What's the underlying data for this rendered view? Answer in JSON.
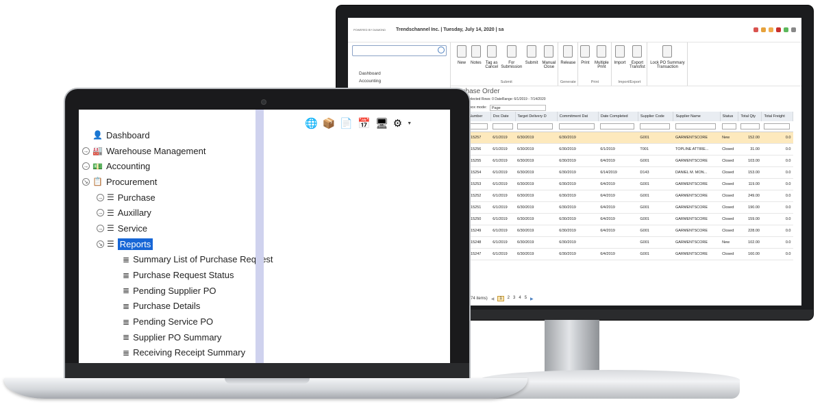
{
  "monitor": {
    "powered_by": "POWERED BY DIAMOND",
    "company_line": "Trendschannel Inc. | Tuesday, July 14, 2020 | sa",
    "sidebar": {
      "search_placeholder": "",
      "items": [
        {
          "label": "Dashboard"
        },
        {
          "label": "Accounting"
        }
      ]
    },
    "ribbon": {
      "groups": [
        {
          "label": "Submit",
          "buttons": [
            "New",
            "Notes",
            "Tag as Cancel",
            "For Submission",
            "Submit",
            "Manual Close"
          ]
        },
        {
          "label": "Generate",
          "buttons": [
            "Release"
          ]
        },
        {
          "label": "Print",
          "buttons": [
            "Print",
            "Multiple Print"
          ]
        },
        {
          "label": "Import/Export",
          "buttons": [
            "Import",
            "Export Transfist"
          ]
        },
        {
          "label": "",
          "buttons": [
            "Lock PO Summary Transaction"
          ]
        }
      ]
    },
    "page_title": "Purchase Order",
    "toolbar_text": "Selected Rows: 0 DateRange: 6/1/2019 - 7/14/2020",
    "checkbox_mode_label": "ct all checkbox mode:",
    "checkbox_mode_value": "Page",
    "grid": {
      "columns": [
        "Doc Number",
        "Doc Date",
        "Target Delivery D",
        "Commitment Dat",
        "Date Completed",
        "Supplier Code",
        "Supplier Name",
        "Status",
        "Total Qty",
        "Total Freight"
      ],
      "rows": [
        [
          "PO0015257",
          "6/1/2019",
          "6/30/2019",
          "6/30/2019",
          "",
          "G001",
          "GARMENTSCORE",
          "New",
          "152.00",
          "0.0"
        ],
        [
          "PO0015256",
          "6/1/2019",
          "6/30/2019",
          "6/30/2019",
          "6/1/2019",
          "T001",
          "TOPLINE ATTIRE...",
          "Closed",
          "31.00",
          "0.0"
        ],
        [
          "PO0015255",
          "6/1/2019",
          "6/30/2019",
          "6/30/2019",
          "6/4/2019",
          "G001",
          "GARMENTSCORE",
          "Closed",
          "103.00",
          "0.0"
        ],
        [
          "PO0015254",
          "6/1/2019",
          "6/30/2019",
          "6/30/2019",
          "6/14/2019",
          "D143",
          "DANIEL M. MON...",
          "Closed",
          "153.00",
          "0.0"
        ],
        [
          "PO0015253",
          "6/1/2019",
          "6/30/2019",
          "6/30/2019",
          "6/4/2019",
          "G001",
          "GARMENTSCORE",
          "Closed",
          "119.00",
          "0.0"
        ],
        [
          "PO0015252",
          "6/1/2019",
          "6/30/2019",
          "6/30/2019",
          "6/4/2019",
          "G001",
          "GARMENTSCORE",
          "Closed",
          "249.00",
          "0.0"
        ],
        [
          "PO0015251",
          "6/1/2019",
          "6/30/2019",
          "6/30/2019",
          "6/4/2019",
          "G001",
          "GARMENTSCORE",
          "Closed",
          "190.00",
          "0.0"
        ],
        [
          "PO0015250",
          "6/1/2019",
          "6/30/2019",
          "6/30/2019",
          "6/4/2019",
          "G001",
          "GARMENTSCORE",
          "Closed",
          "159.00",
          "0.0"
        ],
        [
          "PO0015249",
          "6/1/2019",
          "6/30/2019",
          "6/30/2019",
          "6/4/2019",
          "G001",
          "GARMENTSCORE",
          "Closed",
          "228.00",
          "0.0"
        ],
        [
          "PO0015248",
          "6/1/2019",
          "6/30/2019",
          "6/30/2019",
          "",
          "G001",
          "GARMENTSCORE",
          "New",
          "102.00",
          "0.0"
        ],
        [
          "PO0015247",
          "6/1/2019",
          "6/30/2019",
          "6/30/2019",
          "6/4/2019",
          "G001",
          "GARMENTSCORE",
          "Closed",
          "160.00",
          "0.0"
        ]
      ]
    },
    "pager": {
      "summary": "ge 1 of 5 (74 items)",
      "pages": [
        "1",
        "2",
        "3",
        "4",
        "5"
      ],
      "current": "1"
    }
  },
  "laptop": {
    "tree": [
      {
        "label": "Dashboard",
        "level": 0,
        "toggle": "",
        "icon": "dashboard-icon"
      },
      {
        "label": "Warehouse Management",
        "level": 0,
        "toggle": "expand",
        "icon": "warehouse-icon"
      },
      {
        "label": "Accounting",
        "level": 0,
        "toggle": "expand",
        "icon": "accounting-icon"
      },
      {
        "label": "Procurement",
        "level": 0,
        "toggle": "collapse",
        "icon": "procurement-icon"
      },
      {
        "label": "Purchase",
        "level": 1,
        "toggle": "expand",
        "icon": "list-icon"
      },
      {
        "label": "Auxillary",
        "level": 1,
        "toggle": "expand",
        "icon": "list-icon"
      },
      {
        "label": "Service",
        "level": 1,
        "toggle": "expand",
        "icon": "list-icon"
      },
      {
        "label": "Reports",
        "level": 1,
        "toggle": "collapse",
        "icon": "list-icon",
        "selected": true
      },
      {
        "label": "Summary List of Purchase Request",
        "level": 2,
        "toggle": "",
        "icon": "report-icon"
      },
      {
        "label": "Purchase Request Status",
        "level": 2,
        "toggle": "",
        "icon": "report-icon"
      },
      {
        "label": "Pending Supplier PO",
        "level": 2,
        "toggle": "",
        "icon": "report-icon"
      },
      {
        "label": "Purchase Details",
        "level": 2,
        "toggle": "",
        "icon": "report-icon"
      },
      {
        "label": "Pending Service PO",
        "level": 2,
        "toggle": "",
        "icon": "report-icon"
      },
      {
        "label": "Supplier PO Summary",
        "level": 2,
        "toggle": "",
        "icon": "report-icon"
      },
      {
        "label": "Receiving Receipt Summary",
        "level": 2,
        "toggle": "",
        "icon": "report-icon"
      }
    ],
    "header_icons": [
      "globe-icon",
      "package-icon",
      "document-icon",
      "calendar-icon",
      "monitor-icon",
      "settings-icon"
    ]
  },
  "colors": {
    "selected_bg": "#1766d6",
    "divider": "#cfd2ee",
    "highlight_row": "#fde9bd"
  }
}
